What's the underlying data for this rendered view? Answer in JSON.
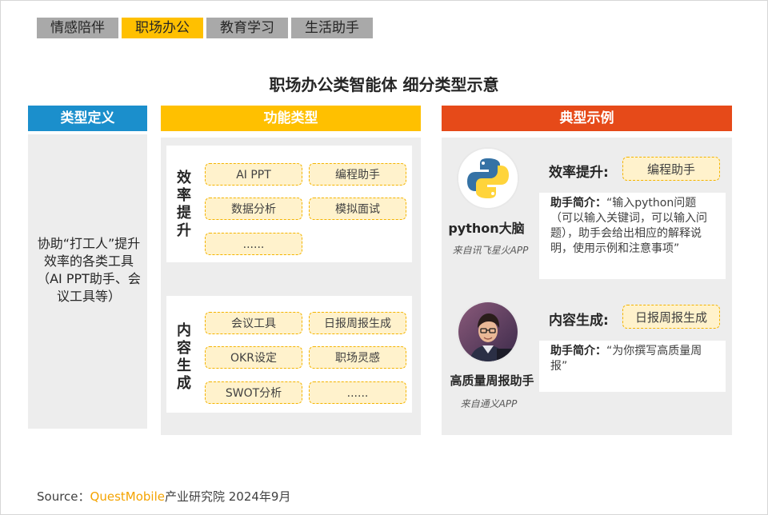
{
  "tabs": [
    {
      "label": "情感陪伴",
      "active": false
    },
    {
      "label": "职场办公",
      "active": true
    },
    {
      "label": "教育学习",
      "active": false
    },
    {
      "label": "生活助手",
      "active": false
    }
  ],
  "title": "职场办公类智能体 细分类型示意",
  "columns": {
    "definition": {
      "header": "类型定义",
      "color": "#1b8fcc"
    },
    "function": {
      "header": "功能类型",
      "color": "#ffc000"
    },
    "examples": {
      "header": "典型示例",
      "color": "#e64a19"
    }
  },
  "definition_text": "协助“打工人”提升效率的各类工具（AI PPT助手、会议工具等）",
  "groups": [
    {
      "label": "效率提升",
      "items": [
        "AI PPT",
        "编程助手",
        "数据分析",
        "模拟面试",
        "......"
      ]
    },
    {
      "label": "内容生成",
      "items": [
        "会议工具",
        "日报周报生成",
        "OKR设定",
        "职场灵感",
        "SWOT分析",
        "......"
      ]
    }
  ],
  "examples": [
    {
      "app": "python大脑",
      "source": "来自讯飞星火APP",
      "category": "效率提升:",
      "tag": "编程助手",
      "intro_label": "助手简介：",
      "intro": "“输入python问题（可以输入关键词，可以输入问题），助手会给出相应的解释说明，使用示例和注意事项”",
      "icon": "python-logo-icon"
    },
    {
      "app": "高质量周报助手",
      "source": "来自通义APP",
      "category": "内容生成:",
      "tag": "日报周报生成",
      "intro_label": "助手简介：",
      "intro": "“为你撰写高质量周报”",
      "icon": "person-avatar-icon"
    }
  ],
  "source": {
    "prefix": "Source：",
    "brand": "QuestMobile",
    "suffix": "产业研究院 2024年9月"
  }
}
